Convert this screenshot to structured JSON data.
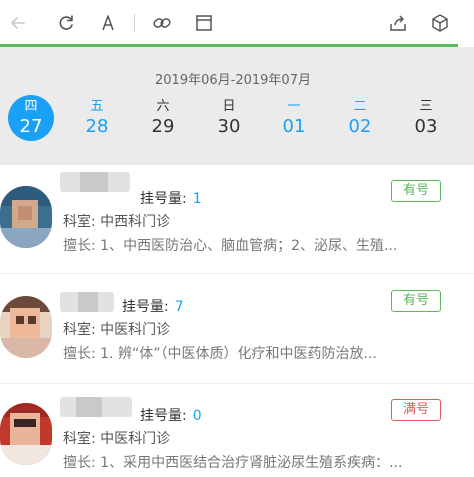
{
  "toolbar": {
    "icons": [
      "back-arrow-icon",
      "refresh-icon",
      "font-size-icon",
      "link-icon",
      "window-icon",
      "share-icon",
      "cube-icon"
    ],
    "progress_color": "#5cb85c"
  },
  "date_range": "2019年06月-2019年07月",
  "days": [
    {
      "weekday": "四",
      "date": "27",
      "selected": true
    },
    {
      "weekday": "五",
      "date": "28",
      "color": "#1aa1f5"
    },
    {
      "weekday": "六",
      "date": "29",
      "color": "#333333"
    },
    {
      "weekday": "日",
      "date": "30",
      "color": "#333333"
    },
    {
      "weekday": "一",
      "date": "01",
      "color": "#1aa1f5"
    },
    {
      "weekday": "二",
      "date": "02",
      "color": "#1aa1f5"
    },
    {
      "weekday": "三",
      "date": "03",
      "color": "#333333"
    }
  ],
  "doctors": [
    {
      "reg_label": "挂号量:",
      "reg_count": "1",
      "dept_label": "科室:",
      "dept": "中西科门诊",
      "specialty": "擅长: 1、中西医防治心、脑血管病；2、泌尿、生殖...",
      "status": "有号",
      "status_type": "ok"
    },
    {
      "reg_label": "挂号量:",
      "reg_count": "7",
      "dept_label": "科室:",
      "dept": "中医科门诊",
      "specialty": "擅长: 1. 辨“体”（中医体质）化疗和中医药防治放...",
      "status": "有号",
      "status_type": "ok"
    },
    {
      "reg_label": "挂号量:",
      "reg_count": "0",
      "dept_label": "科室:",
      "dept": "中医科门诊",
      "specialty": "擅长:  1、采用中西医结合治疗肾脏泌尿生殖系疾病：...",
      "status": "满号",
      "status_type": "full"
    }
  ],
  "colors": {
    "accent": "#1aa1f5",
    "available": "#5cb85c",
    "full": "#e05a5a"
  }
}
